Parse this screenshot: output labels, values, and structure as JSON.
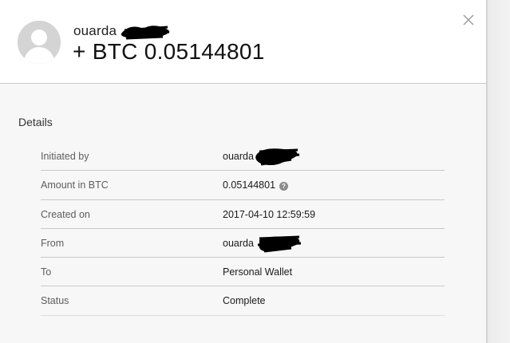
{
  "header": {
    "user_name": "ouarda",
    "amount": "+ BTC 0.05144801",
    "close_icon": "close-icon"
  },
  "details": {
    "title": "Details",
    "rows": [
      {
        "label": "Initiated by",
        "value": "ouarda"
      },
      {
        "label": "Amount in BTC",
        "value": "0.05144801"
      },
      {
        "label": "Created on",
        "value": "2017-04-10 12:59:59"
      },
      {
        "label": "From",
        "value": "ouarda"
      },
      {
        "label": "To",
        "value": "Personal Wallet"
      },
      {
        "label": "Status",
        "value": "Complete"
      }
    ],
    "help_icon": "?"
  },
  "colors": {
    "header_bg": "#ffffff",
    "body_bg": "#f7f7f7",
    "divider": "#c8c8c8",
    "redaction": "#000000"
  }
}
